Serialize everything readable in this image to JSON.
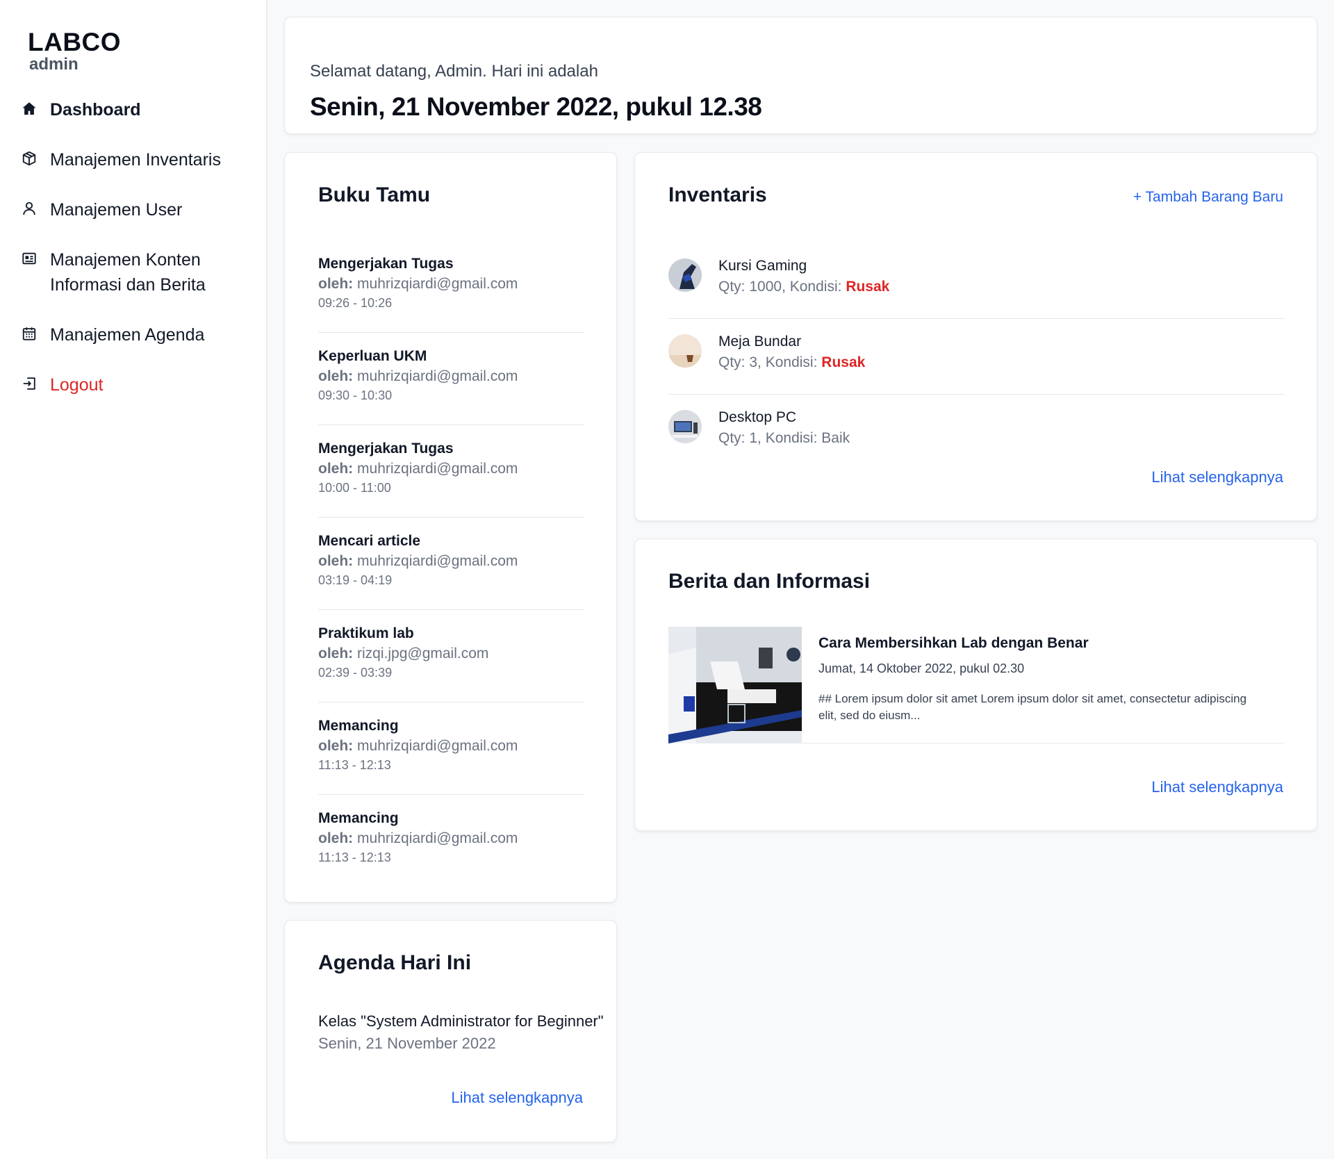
{
  "brand": {
    "title": "LABCO",
    "subtitle": "admin"
  },
  "sidebar": {
    "items": [
      {
        "label": "Dashboard",
        "icon": "home-icon",
        "active": true
      },
      {
        "label": "Manajemen Inventaris",
        "icon": "box-icon"
      },
      {
        "label": "Manajemen User",
        "icon": "user-icon"
      },
      {
        "label": "Manajemen Konten Informasi dan Berita",
        "icon": "newspaper-icon"
      },
      {
        "label": "Manajemen Agenda",
        "icon": "calendar-icon"
      },
      {
        "label": "Logout",
        "icon": "logout-icon",
        "color": "#dc2626"
      }
    ]
  },
  "welcome": {
    "intro": "Selamat datang, Admin. Hari ini adalah",
    "date": "Senin, 21 November 2022, pukul 12.38"
  },
  "guestbook": {
    "title": "Buku Tamu",
    "by_label": "oleh:",
    "entries": [
      {
        "title": "Mengerjakan Tugas",
        "email": "muhrizqiardi@gmail.com",
        "time": "09:26 - 10:26"
      },
      {
        "title": "Keperluan UKM",
        "email": "muhrizqiardi@gmail.com",
        "time": "09:30 - 10:30"
      },
      {
        "title": "Mengerjakan Tugas",
        "email": "muhrizqiardi@gmail.com",
        "time": "10:00 - 11:00"
      },
      {
        "title": "Mencari article",
        "email": "muhrizqiardi@gmail.com",
        "time": "03:19 - 04:19"
      },
      {
        "title": "Praktikum lab",
        "email": "rizqi.jpg@gmail.com",
        "time": "02:39 - 03:39"
      },
      {
        "title": "Memancing",
        "email": "muhrizqiardi@gmail.com",
        "time": "11:13 - 12:13"
      },
      {
        "title": "Memancing",
        "email": "muhrizqiardi@gmail.com",
        "time": "11:13 - 12:13"
      }
    ]
  },
  "agenda": {
    "title": "Agenda Hari Ini",
    "item_title": "Kelas \"System Administrator for Beginner\"",
    "item_date": "Senin, 21 November 2022",
    "more": "Lihat selengkapnya"
  },
  "inventory": {
    "title": "Inventaris",
    "add_label": "+ Tambah Barang Baru",
    "qty_label": "Qty:",
    "condition_label": "Kondisi:",
    "items": [
      {
        "name": "Kursi Gaming",
        "qty": "1000",
        "condition": "Rusak",
        "damaged": true
      },
      {
        "name": "Meja Bundar",
        "qty": "3",
        "condition": "Rusak",
        "damaged": true
      },
      {
        "name": "Desktop PC",
        "qty": "1",
        "condition": "Baik",
        "damaged": false
      }
    ],
    "more": "Lihat selengkapnya"
  },
  "news": {
    "title": "Berita dan Informasi",
    "item": {
      "title": "Cara Membersihkan Lab dengan Benar",
      "date": "Jumat, 14 Oktober 2022, pukul 02.30",
      "excerpt": "## Lorem ipsum dolor sit amet Lorem ipsum dolor sit amet, consectetur adipiscing elit, sed do eiusm..."
    },
    "more": "Lihat selengkapnya"
  },
  "colors": {
    "accent": "#2563eb",
    "danger": "#dc2626",
    "text": "#111827",
    "muted": "#6b7280",
    "background": "#f8f9fb"
  }
}
